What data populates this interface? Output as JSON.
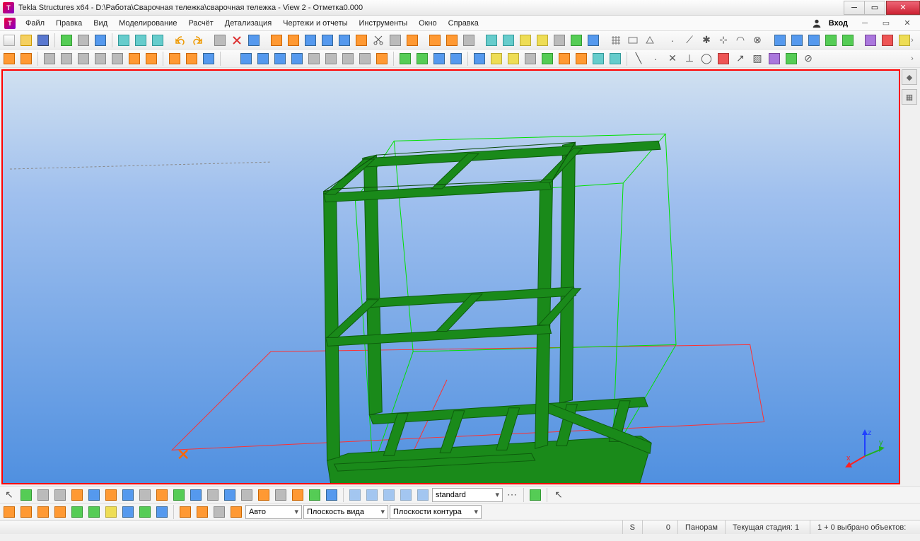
{
  "title": "Tekla Structures x64 - D:\\Работа\\Сварочная тележка\\сварочная тележка  - View 2 - Отметка0.000",
  "login_label": "Вход",
  "menus": [
    "Файл",
    "Правка",
    "Вид",
    "Моделирование",
    "Расчёт",
    "Детализация",
    "Чертежи и отчеты",
    "Инструменты",
    "Окно",
    "Справка"
  ],
  "bottom": {
    "selection_filter": "standard",
    "snap_mode": "Авто",
    "plane_mode": "Плоскость вида",
    "contour_plane": "Плоскости контура"
  },
  "status": {
    "s_label": "S",
    "s_value": "0",
    "view_mode": "Панорам",
    "stage": "Текущая стадия: 1",
    "selected": "1 + 0 выбрано объектов:"
  },
  "axis": {
    "x": "x",
    "y": "y",
    "z": "z"
  }
}
